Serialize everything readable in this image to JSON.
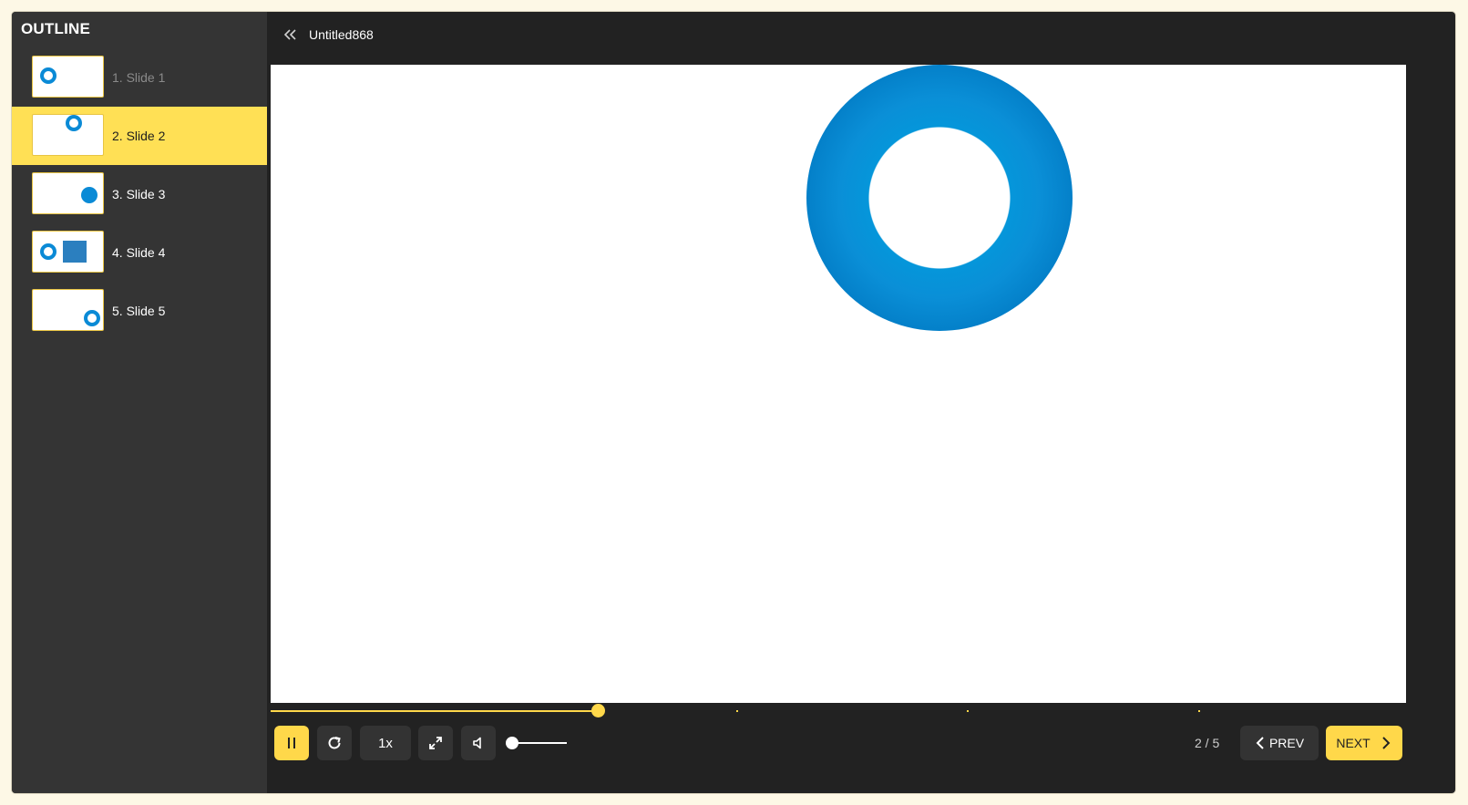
{
  "sidebar": {
    "title": "OUTLINE",
    "items": [
      {
        "label": "1. Slide 1"
      },
      {
        "label": "2. Slide 2"
      },
      {
        "label": "3. Slide 3"
      },
      {
        "label": "4. Slide 4"
      },
      {
        "label": "5. Slide 5"
      }
    ]
  },
  "header": {
    "title": "Untitled868"
  },
  "player": {
    "progress_fraction": 0.288,
    "slide_marks_fraction": [
      0.0,
      0.41,
      0.613,
      0.817
    ],
    "volume_fraction": 0.0
  },
  "controls": {
    "speed_label": "1x",
    "page_counter": "2 / 5",
    "prev_label": "PREV",
    "next_label": "NEXT"
  },
  "colors": {
    "accent": "#ffd84a",
    "panel": "#222222",
    "sidebar": "#343434",
    "shape_blue": "#0a8ad6"
  },
  "icons": {
    "collapse": "double-chevron-left-icon",
    "pause": "pause-icon",
    "replay": "replay-icon",
    "fullscreen": "expand-icon",
    "volume": "speaker-icon",
    "prev": "chevron-left-icon",
    "next": "chevron-right-icon"
  }
}
